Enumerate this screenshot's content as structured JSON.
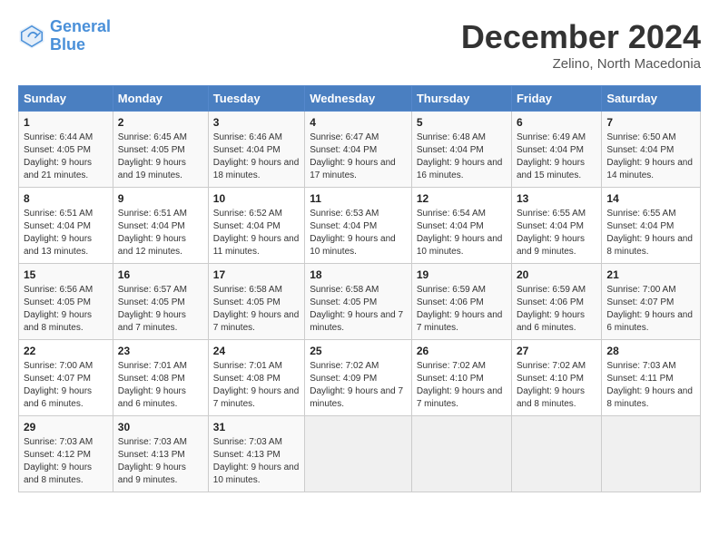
{
  "header": {
    "logo_line1": "General",
    "logo_line2": "Blue",
    "month": "December 2024",
    "location": "Zelino, North Macedonia"
  },
  "weekdays": [
    "Sunday",
    "Monday",
    "Tuesday",
    "Wednesday",
    "Thursday",
    "Friday",
    "Saturday"
  ],
  "weeks": [
    [
      {
        "day": "1",
        "sunrise": "6:44 AM",
        "sunset": "4:05 PM",
        "daylight": "9 hours and 21 minutes."
      },
      {
        "day": "2",
        "sunrise": "6:45 AM",
        "sunset": "4:05 PM",
        "daylight": "9 hours and 19 minutes."
      },
      {
        "day": "3",
        "sunrise": "6:46 AM",
        "sunset": "4:04 PM",
        "daylight": "9 hours and 18 minutes."
      },
      {
        "day": "4",
        "sunrise": "6:47 AM",
        "sunset": "4:04 PM",
        "daylight": "9 hours and 17 minutes."
      },
      {
        "day": "5",
        "sunrise": "6:48 AM",
        "sunset": "4:04 PM",
        "daylight": "9 hours and 16 minutes."
      },
      {
        "day": "6",
        "sunrise": "6:49 AM",
        "sunset": "4:04 PM",
        "daylight": "9 hours and 15 minutes."
      },
      {
        "day": "7",
        "sunrise": "6:50 AM",
        "sunset": "4:04 PM",
        "daylight": "9 hours and 14 minutes."
      }
    ],
    [
      {
        "day": "8",
        "sunrise": "6:51 AM",
        "sunset": "4:04 PM",
        "daylight": "9 hours and 13 minutes."
      },
      {
        "day": "9",
        "sunrise": "6:51 AM",
        "sunset": "4:04 PM",
        "daylight": "9 hours and 12 minutes."
      },
      {
        "day": "10",
        "sunrise": "6:52 AM",
        "sunset": "4:04 PM",
        "daylight": "9 hours and 11 minutes."
      },
      {
        "day": "11",
        "sunrise": "6:53 AM",
        "sunset": "4:04 PM",
        "daylight": "9 hours and 10 minutes."
      },
      {
        "day": "12",
        "sunrise": "6:54 AM",
        "sunset": "4:04 PM",
        "daylight": "9 hours and 10 minutes."
      },
      {
        "day": "13",
        "sunrise": "6:55 AM",
        "sunset": "4:04 PM",
        "daylight": "9 hours and 9 minutes."
      },
      {
        "day": "14",
        "sunrise": "6:55 AM",
        "sunset": "4:04 PM",
        "daylight": "9 hours and 8 minutes."
      }
    ],
    [
      {
        "day": "15",
        "sunrise": "6:56 AM",
        "sunset": "4:05 PM",
        "daylight": "9 hours and 8 minutes."
      },
      {
        "day": "16",
        "sunrise": "6:57 AM",
        "sunset": "4:05 PM",
        "daylight": "9 hours and 7 minutes."
      },
      {
        "day": "17",
        "sunrise": "6:58 AM",
        "sunset": "4:05 PM",
        "daylight": "9 hours and 7 minutes."
      },
      {
        "day": "18",
        "sunrise": "6:58 AM",
        "sunset": "4:05 PM",
        "daylight": "9 hours and 7 minutes."
      },
      {
        "day": "19",
        "sunrise": "6:59 AM",
        "sunset": "4:06 PM",
        "daylight": "9 hours and 7 minutes."
      },
      {
        "day": "20",
        "sunrise": "6:59 AM",
        "sunset": "4:06 PM",
        "daylight": "9 hours and 6 minutes."
      },
      {
        "day": "21",
        "sunrise": "7:00 AM",
        "sunset": "4:07 PM",
        "daylight": "9 hours and 6 minutes."
      }
    ],
    [
      {
        "day": "22",
        "sunrise": "7:00 AM",
        "sunset": "4:07 PM",
        "daylight": "9 hours and 6 minutes."
      },
      {
        "day": "23",
        "sunrise": "7:01 AM",
        "sunset": "4:08 PM",
        "daylight": "9 hours and 6 minutes."
      },
      {
        "day": "24",
        "sunrise": "7:01 AM",
        "sunset": "4:08 PM",
        "daylight": "9 hours and 7 minutes."
      },
      {
        "day": "25",
        "sunrise": "7:02 AM",
        "sunset": "4:09 PM",
        "daylight": "9 hours and 7 minutes."
      },
      {
        "day": "26",
        "sunrise": "7:02 AM",
        "sunset": "4:10 PM",
        "daylight": "9 hours and 7 minutes."
      },
      {
        "day": "27",
        "sunrise": "7:02 AM",
        "sunset": "4:10 PM",
        "daylight": "9 hours and 8 minutes."
      },
      {
        "day": "28",
        "sunrise": "7:03 AM",
        "sunset": "4:11 PM",
        "daylight": "9 hours and 8 minutes."
      }
    ],
    [
      {
        "day": "29",
        "sunrise": "7:03 AM",
        "sunset": "4:12 PM",
        "daylight": "9 hours and 8 minutes."
      },
      {
        "day": "30",
        "sunrise": "7:03 AM",
        "sunset": "4:13 PM",
        "daylight": "9 hours and 9 minutes."
      },
      {
        "day": "31",
        "sunrise": "7:03 AM",
        "sunset": "4:13 PM",
        "daylight": "9 hours and 10 minutes."
      },
      null,
      null,
      null,
      null
    ]
  ]
}
